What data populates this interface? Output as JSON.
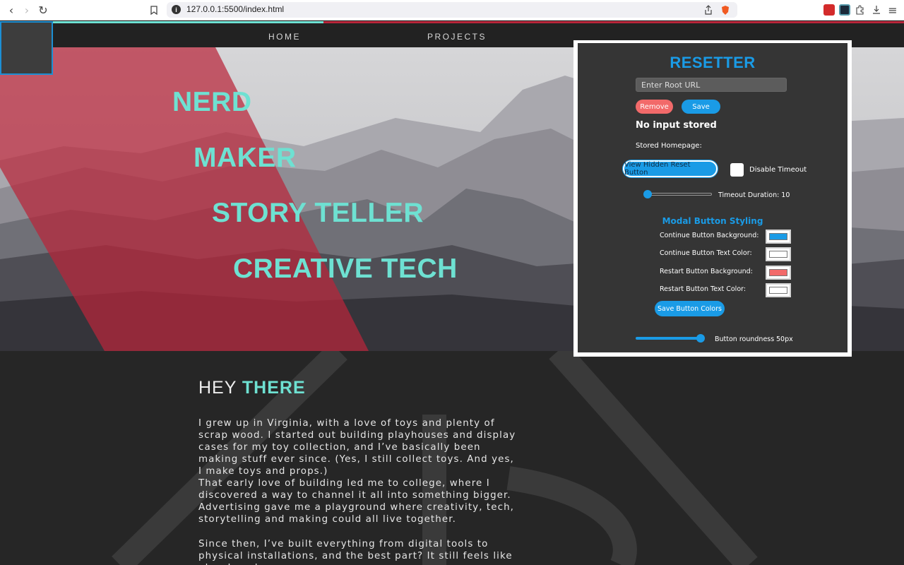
{
  "browser": {
    "url": "127.0.0.1:5500/index.html",
    "info_glyph": "i"
  },
  "nav": {
    "home": "HOME",
    "projects": "PROJECTS"
  },
  "hero": {
    "words": [
      "NERD",
      "MAKER",
      "STORY TELLER",
      "CREATIVE TECH"
    ]
  },
  "about": {
    "title_plain": "HEY",
    "title_highlight": "THERE",
    "p1": "I grew up in Virginia, with a love of toys and plenty of scrap wood. I started out building playhouses and display cases for my toy collection, and I’ve basically been making stuff ever since. (Yes, I still collect toys. And yes, I make toys and props.)",
    "p2": "That early love of building led me to college, where I discovered a way to channel it all into something bigger. Advertising gave me a playground where creativity, tech, storytelling and making could all live together.",
    "p3": "Since then, I’ve built everything from digital tools to physical installations, and the best part? It still feels like play. I work"
  },
  "popup": {
    "title": "RESETTER",
    "root_url_placeholder": "Enter Root URL",
    "remove_label": "Remove",
    "save_label": "Save",
    "status": "No input stored",
    "stored_homepage_label": "Stored Homepage:",
    "view_hidden_label": "View Hidden Reset Button",
    "disable_timeout_label": "Disable Timeout",
    "timeout_label": "Timeout Duration: 10",
    "timeout_value": 10,
    "modal_heading": "Modal Button Styling",
    "color_rows": [
      {
        "label": "Continue Button Background:",
        "color": "#1a9be6"
      },
      {
        "label": "Continue Button Text Color:",
        "color": "#ffffff"
      },
      {
        "label": "Restart Button Background:",
        "color": "#f26a6a"
      },
      {
        "label": "Restart Button Text Color:",
        "color": "#ffffff"
      }
    ],
    "save_colors_label": "Save Button Colors",
    "roundness_label": "Button roundness",
    "roundness_value": "50px"
  },
  "colors": {
    "accent_teal": "#6ee1d2",
    "accent_red": "#b8263a",
    "popup_blue": "#1a9be6",
    "remove_red": "#f26a6a"
  }
}
